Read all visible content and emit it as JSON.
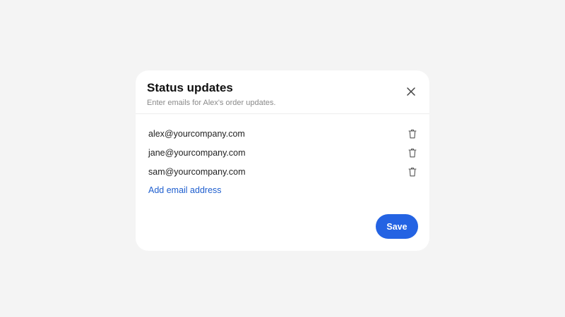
{
  "modal": {
    "title": "Status updates",
    "subtitle": "Enter emails for Alex's order updates.",
    "close_icon": "close-icon",
    "emails": [
      {
        "address": "alex@yourcompany.com",
        "delete_icon": "trash-icon"
      },
      {
        "address": "jane@yourcompany.com",
        "delete_icon": "trash-icon"
      },
      {
        "address": "sam@yourcompany.com",
        "delete_icon": "trash-icon"
      }
    ],
    "add_label": "Add email address",
    "save_label": "Save"
  },
  "colors": {
    "background": "#f4f4f4",
    "card": "#ffffff",
    "link": "#1f5fcf",
    "primary": "#2463e3"
  }
}
